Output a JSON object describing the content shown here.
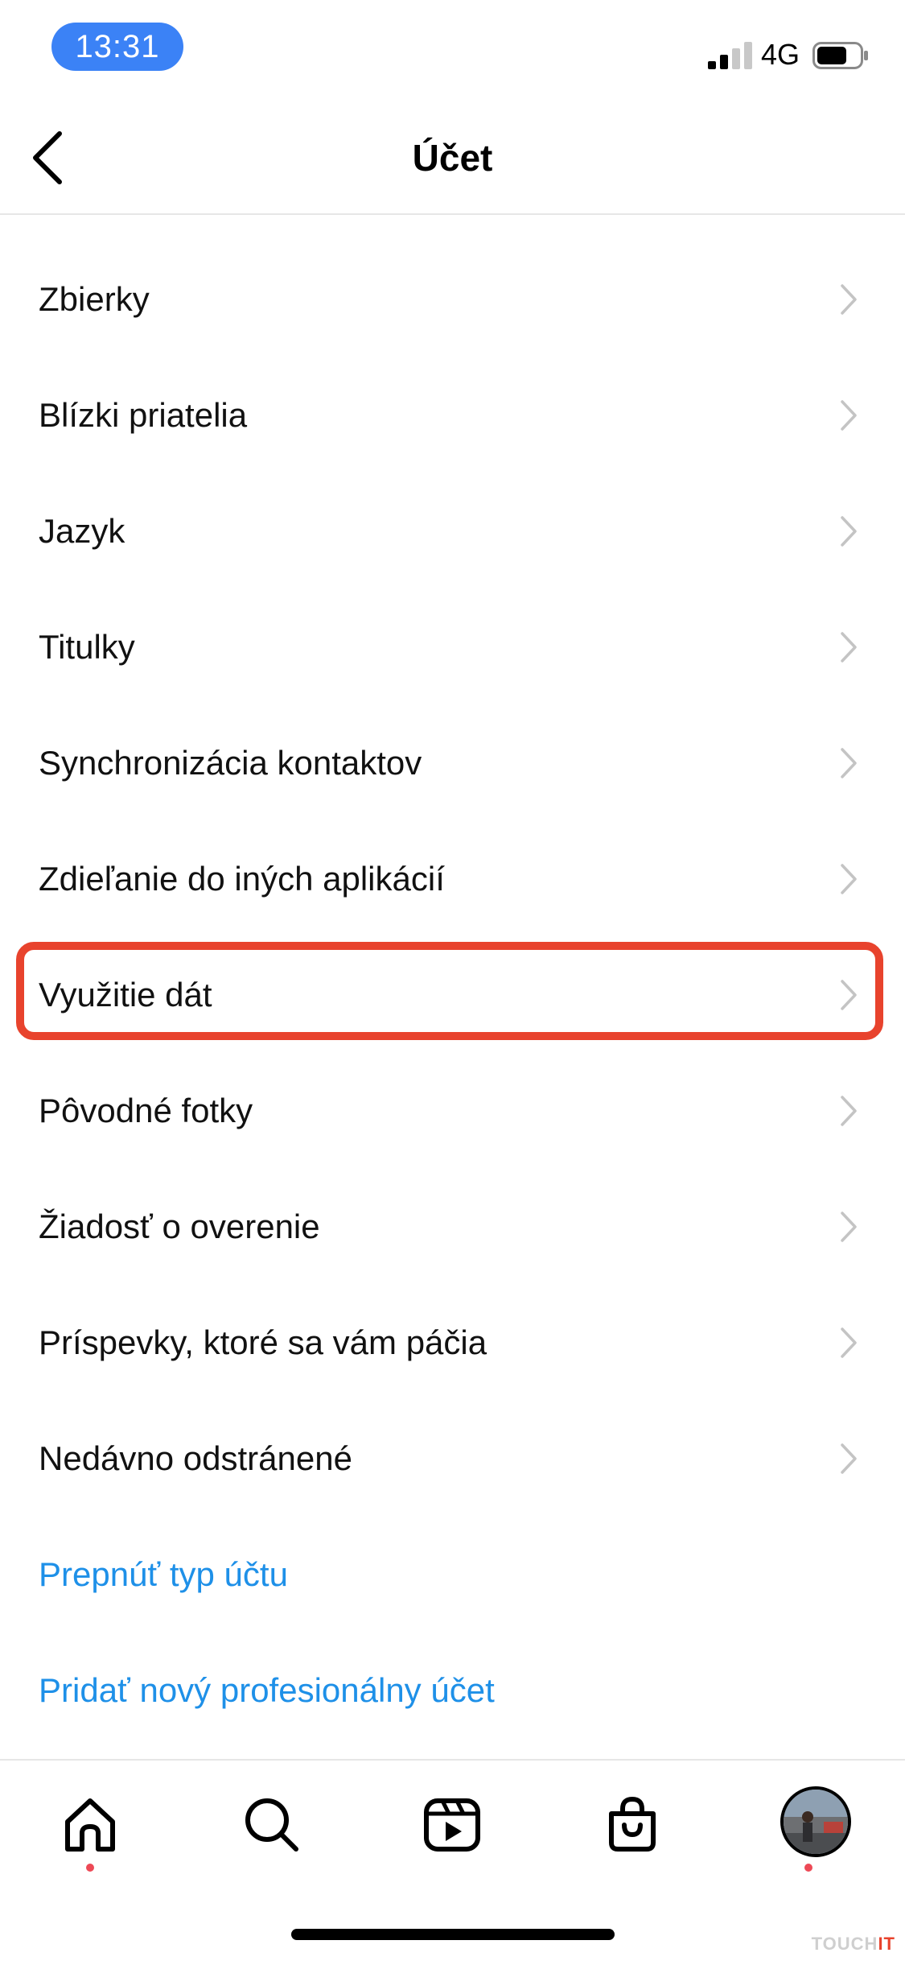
{
  "status_bar": {
    "time": "13:31",
    "network": "4G",
    "icons": [
      "signal-icon",
      "battery-icon"
    ]
  },
  "header": {
    "title": "Účet",
    "back_icon": "chevron-left-icon"
  },
  "menu": {
    "items": [
      {
        "label": "Zbierky"
      },
      {
        "label": "Blízki priatelia"
      },
      {
        "label": "Jazyk"
      },
      {
        "label": "Titulky"
      },
      {
        "label": "Synchronizácia kontaktov"
      },
      {
        "label": "Zdieľanie do iných aplikácií"
      },
      {
        "label": "Využitie dát",
        "highlighted": true
      },
      {
        "label": "Pôvodné fotky"
      },
      {
        "label": "Žiadosť o overenie"
      },
      {
        "label": "Príspevky, ktoré sa vám páčia"
      },
      {
        "label": "Nedávno odstránené"
      }
    ],
    "links": [
      {
        "label": "Prepnúť typ účtu"
      },
      {
        "label": "Pridať nový profesionálny účet"
      }
    ]
  },
  "tab_bar": {
    "tabs": [
      "home-icon",
      "search-icon",
      "reels-icon",
      "shop-icon",
      "profile-avatar"
    ]
  },
  "watermark": {
    "prefix": "TOUCH",
    "suffix": "IT"
  },
  "colors": {
    "time_pill": "#3b82f6",
    "link": "#1e90e8",
    "highlight": "#e8432d",
    "notification": "#ed4956"
  }
}
